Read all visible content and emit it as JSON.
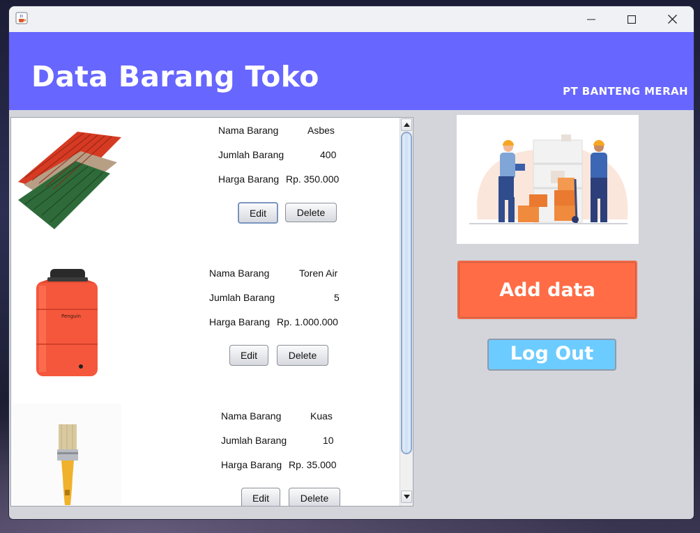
{
  "window": {
    "minimize_icon": "minimize-icon",
    "maximize_icon": "maximize-icon",
    "close_icon": "close-icon",
    "app_icon": "java-coffee-icon"
  },
  "header": {
    "title": "Data Barang Toko",
    "company": "PT BANTENG MERAH",
    "color": "#6766ff"
  },
  "items": [
    {
      "name_label": "Nama Barang",
      "name": "Asbes",
      "qty_label": "Jumlah Barang",
      "qty": "400",
      "price_label": "Harga Barang",
      "price": "Rp. 350.000",
      "edit": "Edit",
      "delete": "Delete",
      "image": "corrugated-roof-sheets"
    },
    {
      "name_label": "Nama Barang",
      "name": "Toren Air",
      "qty_label": "Jumlah Barang",
      "qty": "5",
      "price_label": "Harga Barang",
      "price": "Rp. 1.000.000",
      "edit": "Edit",
      "delete": "Delete",
      "image": "water-tank"
    },
    {
      "name_label": "Nama Barang",
      "name": "Kuas",
      "qty_label": "Jumlah Barang",
      "qty": "10",
      "price_label": "Harga Barang",
      "price": "Rp. 35.000",
      "edit": "Edit",
      "delete": "Delete",
      "image": "paint-brush"
    }
  ],
  "sidebar": {
    "add_label": "Add data",
    "logout_label": "Log Out",
    "illustration": "warehouse-workers-illustration",
    "add_color": "#ff6c45",
    "logout_color": "#6cccff"
  }
}
